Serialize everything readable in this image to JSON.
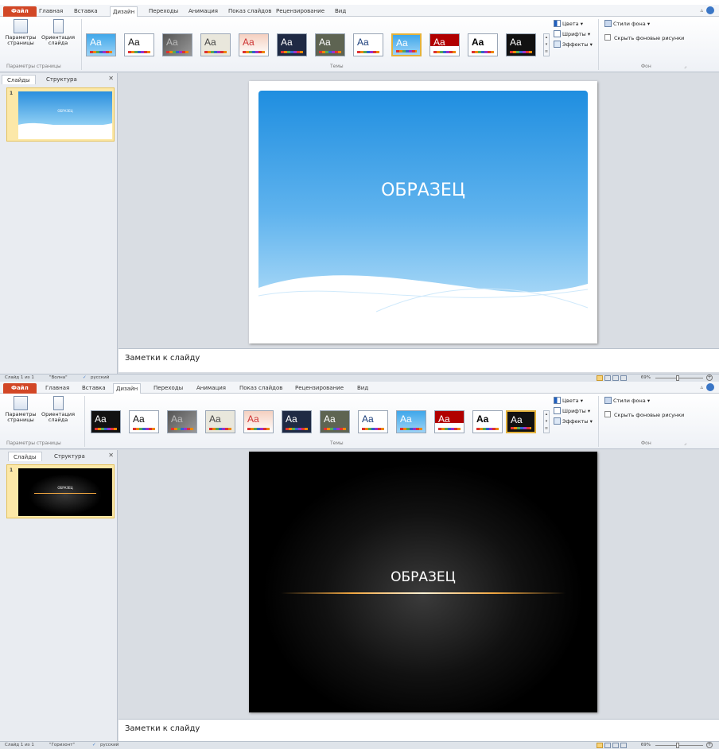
{
  "windows": [
    {
      "tabs": [
        {
          "label": "Файл"
        },
        {
          "label": "Главная"
        },
        {
          "label": "Вставка"
        },
        {
          "label": "Дизайн"
        },
        {
          "label": "Переходы"
        },
        {
          "label": "Анимация"
        },
        {
          "label": "Показ слайдов"
        },
        {
          "label": "Рецензирование"
        },
        {
          "label": "Вид"
        }
      ],
      "page_setup": {
        "params_label": "Параметры страницы",
        "orient_label": "Ориентация слайда",
        "group_label": "Параметры страницы"
      },
      "themes_group_label": "Темы",
      "theme_buttons": {
        "colors": "Цвета",
        "fonts": "Шрифты",
        "effects": "Эффекты"
      },
      "background": {
        "styles": "Стили фона",
        "hide_graphics": "Скрыть фоновые рисунки",
        "group_label": "Фон"
      },
      "left_panel": {
        "tab_slides": "Слайды",
        "tab_outline": "Структура",
        "slide_number": "1"
      },
      "slide": {
        "title": "ОБРАЗЕЦ",
        "theme": "Волна"
      },
      "notes_placeholder": "Заметки к слайду",
      "status": {
        "slide_counter": "Слайд 1 из 1",
        "theme_name": "\"Волна\"",
        "language": "русский",
        "zoom": "69%"
      }
    },
    {
      "tabs": [
        {
          "label": "Файл"
        },
        {
          "label": "Главная"
        },
        {
          "label": "Вставка"
        },
        {
          "label": "Дизайн"
        },
        {
          "label": "Переходы"
        },
        {
          "label": "Анимация"
        },
        {
          "label": "Показ слайдов"
        },
        {
          "label": "Рецензирование"
        },
        {
          "label": "Вид"
        }
      ],
      "page_setup": {
        "params_label": "Параметры страницы",
        "orient_label": "Ориентация слайда",
        "group_label": "Параметры страницы"
      },
      "themes_group_label": "Темы",
      "theme_buttons": {
        "colors": "Цвета",
        "fonts": "Шрифты",
        "effects": "Эффекты"
      },
      "background": {
        "styles": "Стили фона",
        "hide_graphics": "Скрыть фоновые рисунки",
        "group_label": "Фон"
      },
      "left_panel": {
        "tab_slides": "Слайды",
        "tab_outline": "Структура",
        "slide_number": "1"
      },
      "slide": {
        "title": "ОБРАЗЕЦ",
        "theme": "Горизонт"
      },
      "notes_placeholder": "Заметки к слайду",
      "status": {
        "slide_counter": "Слайд 1 из 1",
        "theme_name": "\"Горизонт\"",
        "language": "русский",
        "zoom": "69%"
      }
    }
  ],
  "colors": {
    "file_tab": "#d24726",
    "selected_border": "#e3b23c",
    "wave_blue": "#1f8ee0",
    "horizon_glow": "#f0a640"
  }
}
